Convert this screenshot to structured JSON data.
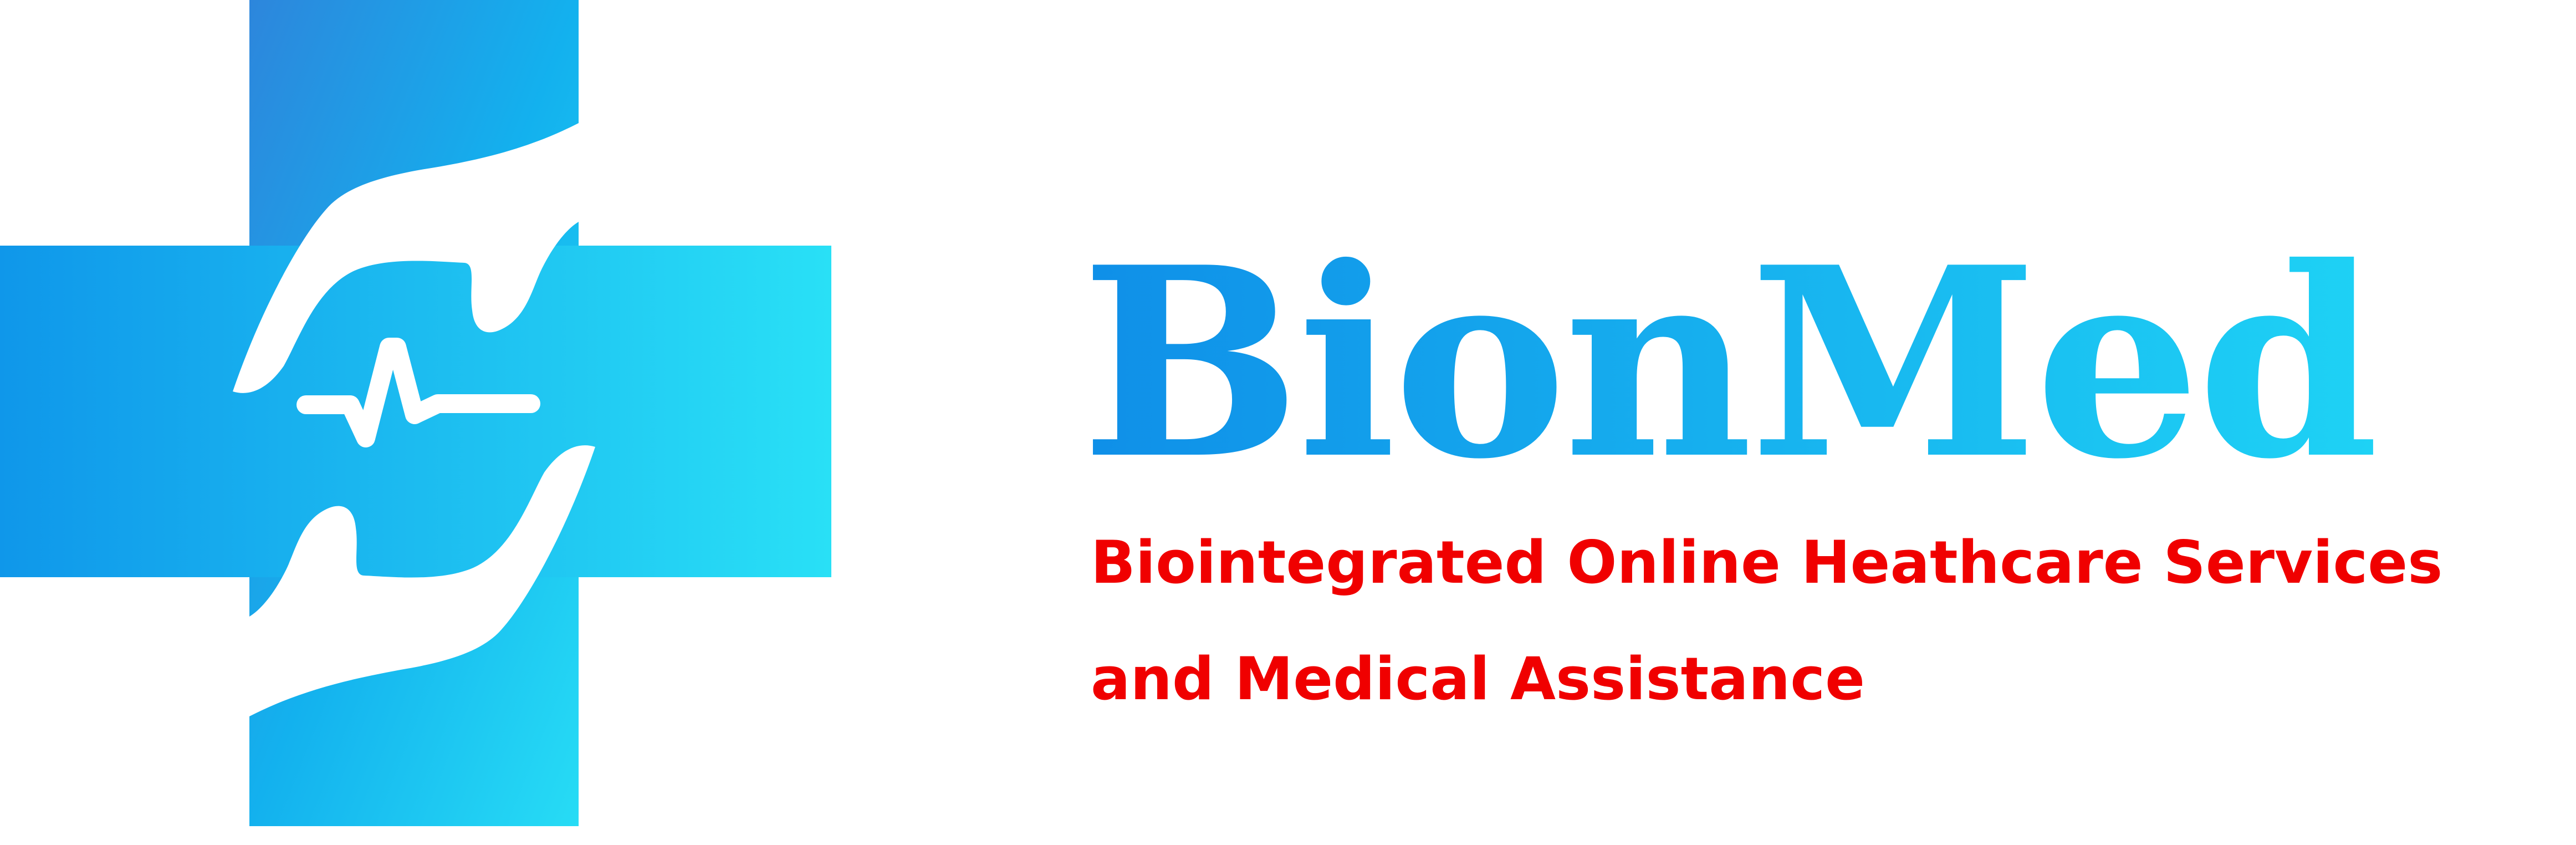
{
  "logo": {
    "icon": "medical-cross-caring-hands-heartbeat-icon",
    "gradient_start": "#2d86dc",
    "gradient_mid": "#13b1ee",
    "gradient_end": "#27dcf5",
    "symbol_color": "#ffffff"
  },
  "brand": {
    "name": "BionMed",
    "gradient": [
      "#0f8fe8",
      "#1ed2f5"
    ]
  },
  "tagline": {
    "line1": "Biointegrated Online Heathcare Services",
    "line2": "and Medical Assistance",
    "color": "#f00000"
  }
}
